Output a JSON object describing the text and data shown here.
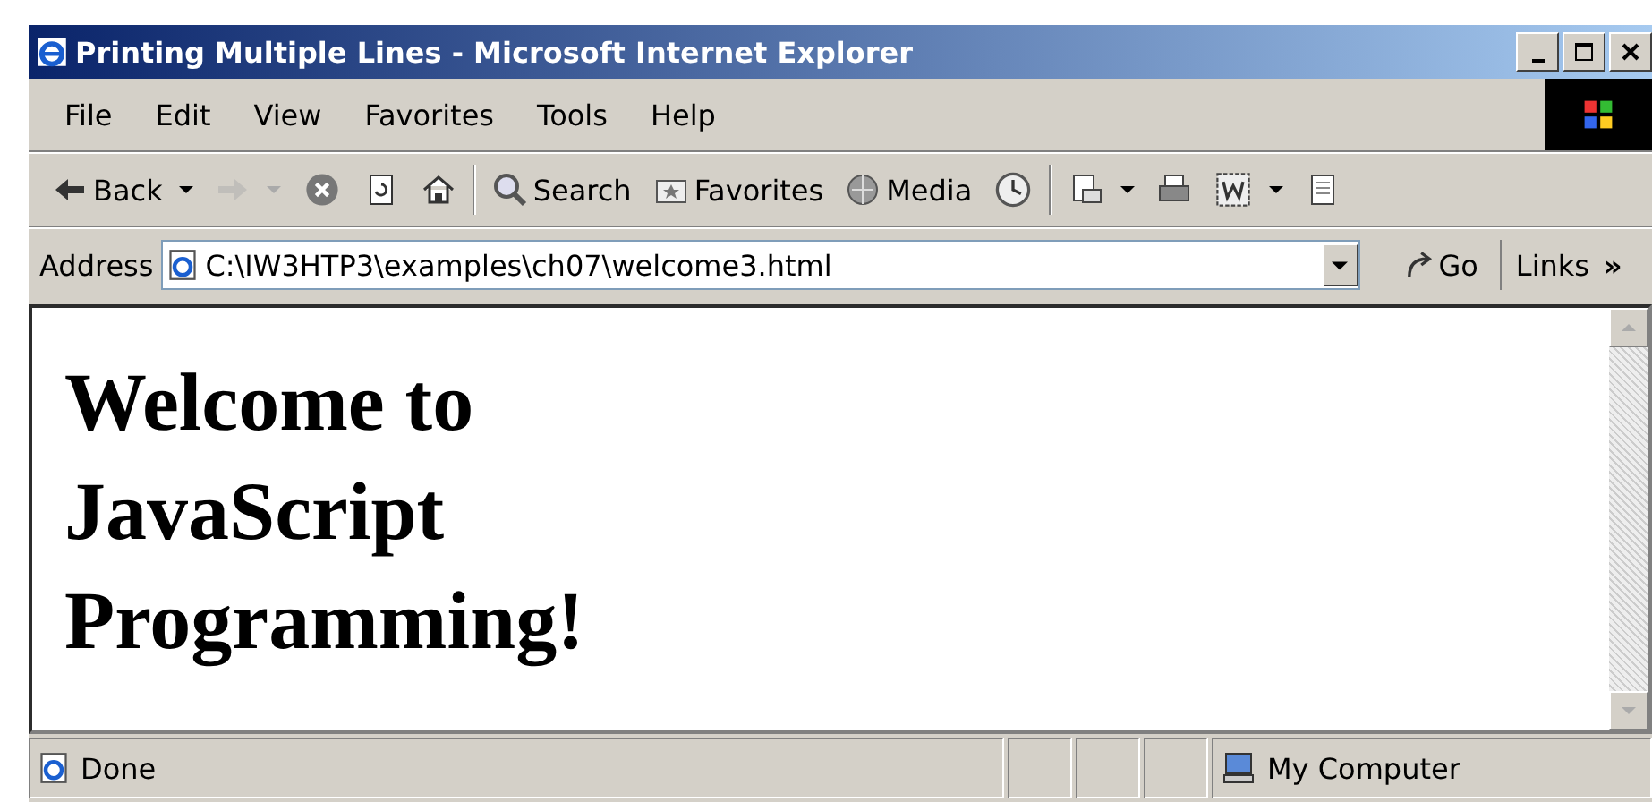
{
  "window": {
    "title": "Printing Multiple Lines - Microsoft Internet Explorer"
  },
  "menu": [
    "File",
    "Edit",
    "View",
    "Favorites",
    "Tools",
    "Help"
  ],
  "toolbar": [
    {
      "kind": "back",
      "label": "Back",
      "dropdown": true,
      "disabled": false
    },
    {
      "kind": "forward",
      "dropdown": true,
      "disabled": true
    },
    {
      "kind": "stop",
      "dropdown": false,
      "disabled": false
    },
    {
      "kind": "refresh",
      "dropdown": false,
      "disabled": false
    },
    {
      "kind": "home",
      "dropdown": false,
      "disabled": false
    },
    {
      "kind": "separator"
    },
    {
      "kind": "search",
      "label": "Search",
      "dropdown": false,
      "disabled": false
    },
    {
      "kind": "favorites",
      "label": "Favorites",
      "dropdown": false,
      "disabled": false
    },
    {
      "kind": "media",
      "label": "Media",
      "dropdown": false,
      "disabled": false
    },
    {
      "kind": "history",
      "dropdown": false,
      "disabled": false
    },
    {
      "kind": "separator"
    },
    {
      "kind": "mail",
      "dropdown": true,
      "disabled": false
    },
    {
      "kind": "print",
      "dropdown": false,
      "disabled": false
    },
    {
      "kind": "edit",
      "dropdown": true,
      "disabled": false
    },
    {
      "kind": "discuss",
      "dropdown": false,
      "disabled": false
    }
  ],
  "address": {
    "label": "Address",
    "value": "C:\\IW3HTP3\\examples\\ch07\\welcome3.html",
    "go": "Go",
    "links": "Links",
    "more": "»"
  },
  "page": {
    "heading_lines": [
      "Welcome to",
      "JavaScript",
      "Programming!"
    ]
  },
  "status_bar": {
    "text": "Done",
    "zone": "My Computer"
  }
}
